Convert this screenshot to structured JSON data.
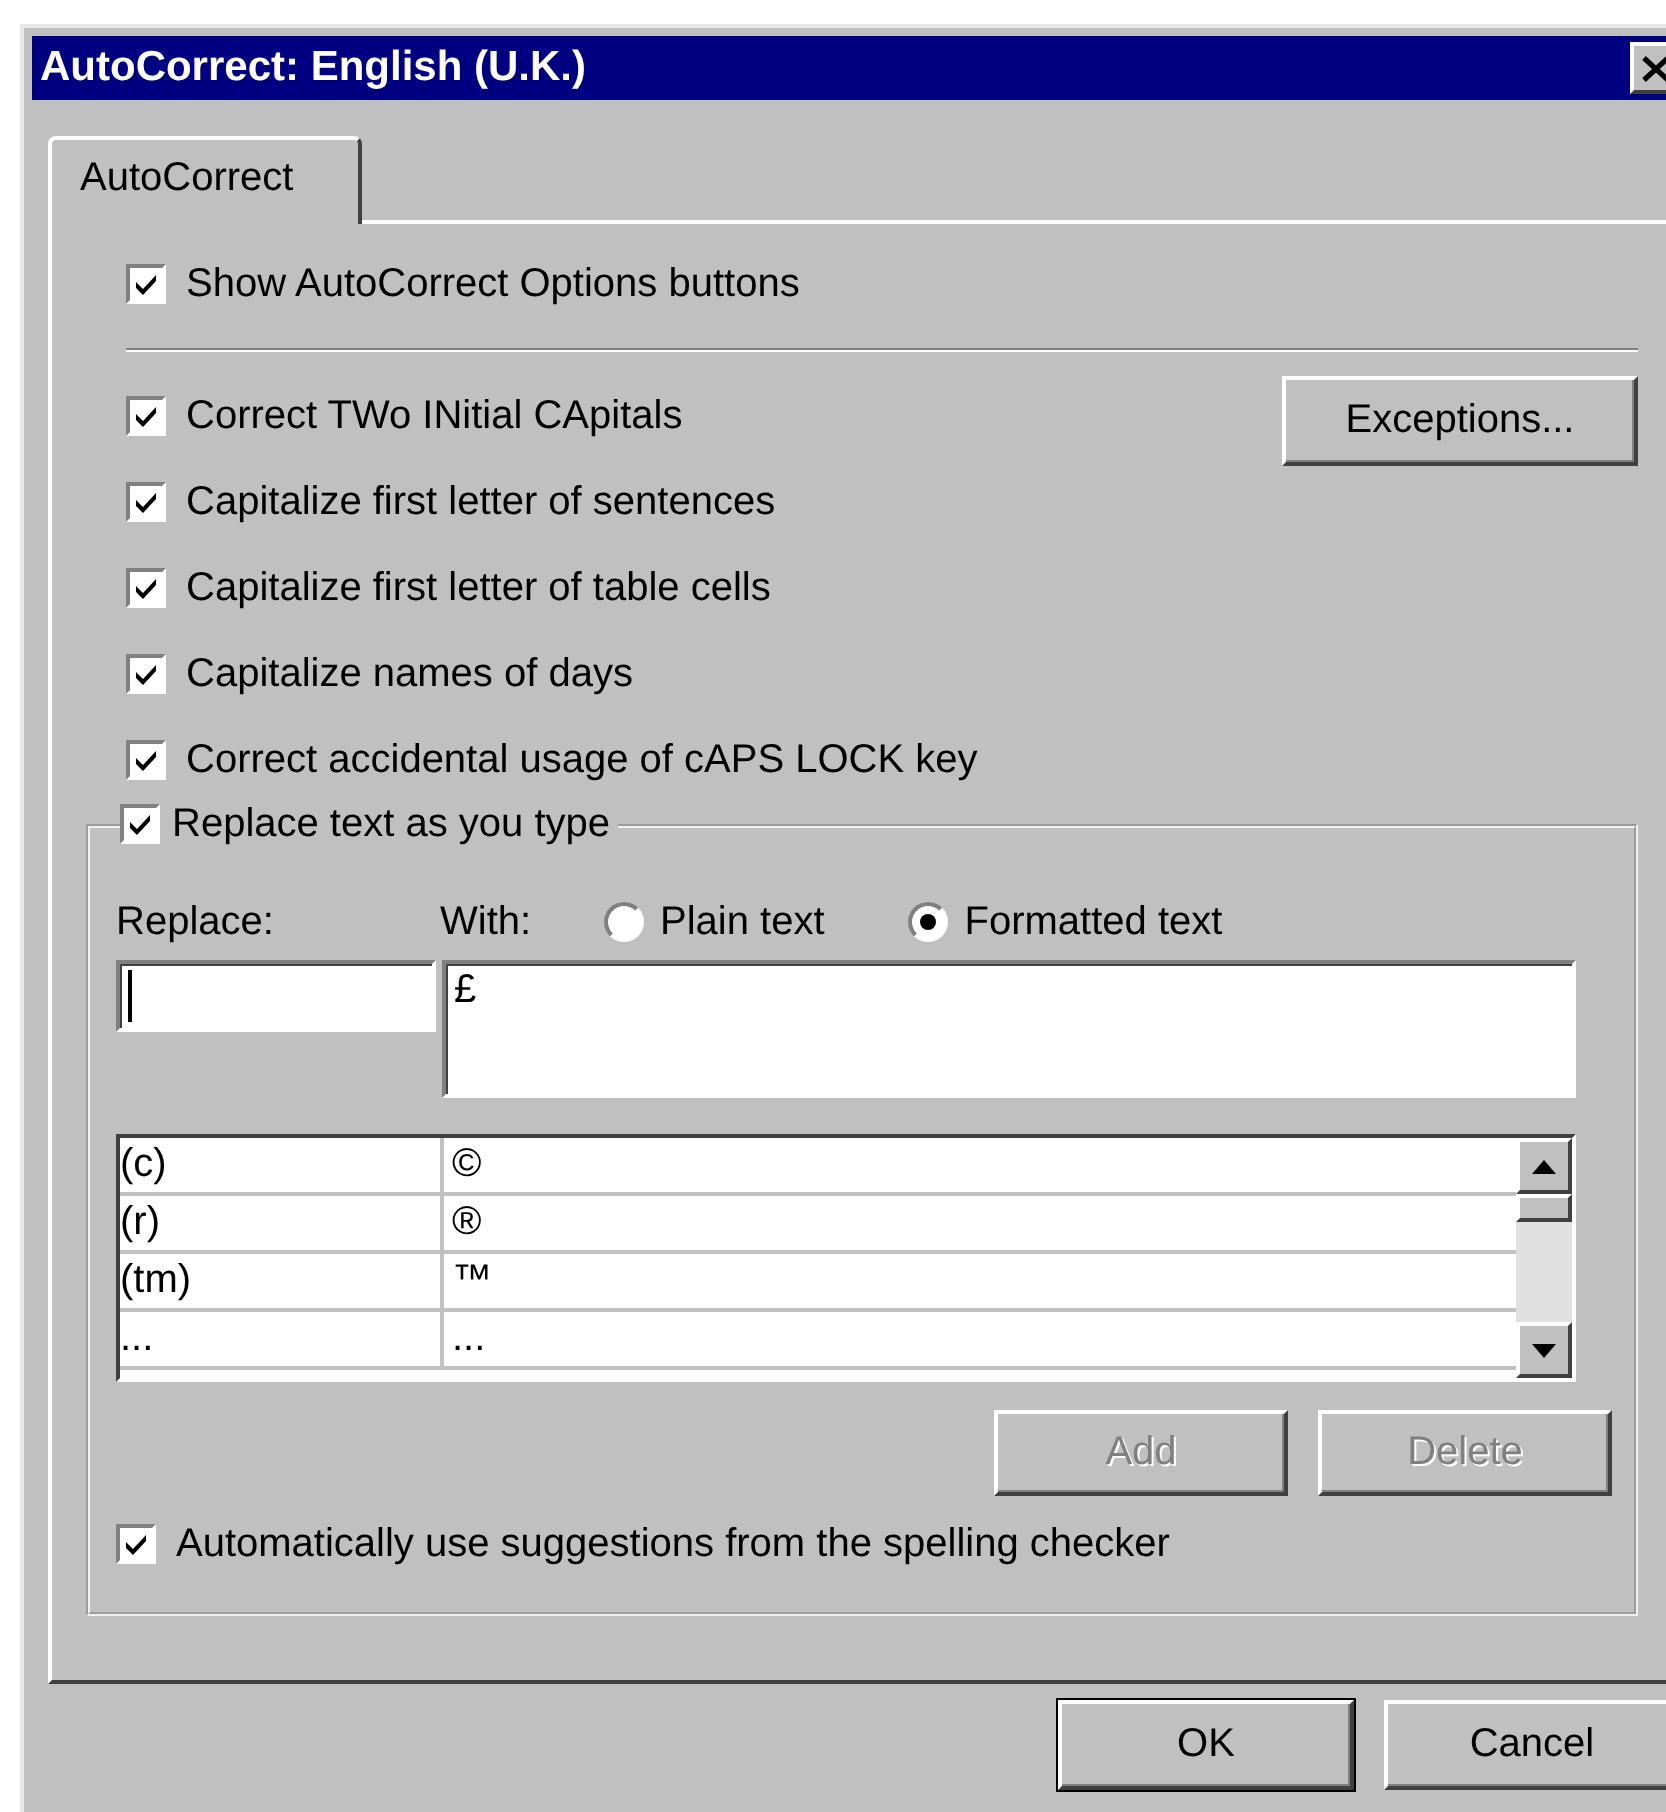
{
  "window": {
    "title": "AutoCorrect: English (U.K.)"
  },
  "tabs": [
    {
      "label": "AutoCorrect",
      "selected": true
    }
  ],
  "options": [
    {
      "label": "Show AutoCorrect Options buttons",
      "checked": true
    }
  ],
  "rules": [
    {
      "label": "Correct TWo INitial CApitals",
      "checked": true
    },
    {
      "label": "Capitalize first letter of sentences",
      "checked": true
    },
    {
      "label": "Capitalize first letter of table cells",
      "checked": true
    },
    {
      "label": "Capitalize names of days",
      "checked": true
    },
    {
      "label": "Correct accidental usage of cAPS LOCK key",
      "checked": true
    }
  ],
  "exceptions_button": "Exceptions...",
  "replace_group": {
    "label": "Replace text as you type",
    "checked": true,
    "replace_label": "Replace:",
    "with_label": "With:",
    "formats": [
      {
        "label": "Plain text",
        "selected": false
      },
      {
        "label": "Formatted text",
        "selected": true
      }
    ],
    "with_value": "£",
    "entries": [
      {
        "replace": "(c)",
        "with": "©"
      },
      {
        "replace": "(r)",
        "with": "®"
      },
      {
        "replace": "(tm)",
        "with": "™"
      },
      {
        "replace": "...",
        "with": "..."
      }
    ],
    "buttons": [
      {
        "label": "Add",
        "disabled": true
      },
      {
        "label": "Delete",
        "disabled": true
      }
    ],
    "suggestions": {
      "label": "Automatically use suggestions from the spelling checker",
      "checked": true
    }
  },
  "buttons": [
    "OK",
    "Cancel"
  ]
}
